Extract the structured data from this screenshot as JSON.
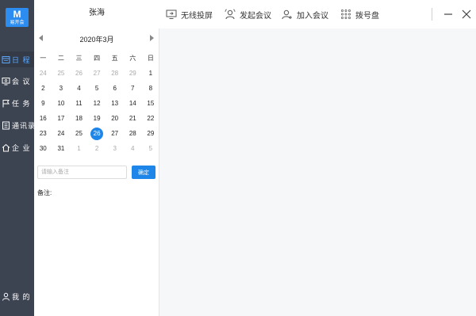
{
  "app": {
    "logo_mark": "M",
    "logo_text": "易开会"
  },
  "sidebar": {
    "items": [
      {
        "label": "日 程",
        "icon": "calendar-icon",
        "active": true
      },
      {
        "label": "会 议",
        "icon": "monitor-icon",
        "active": false
      },
      {
        "label": "任 务",
        "icon": "flag-icon",
        "active": false
      },
      {
        "label": "通讯录",
        "icon": "contacts-icon",
        "active": false
      },
      {
        "label": "企 业",
        "icon": "home-icon",
        "active": false
      }
    ],
    "profile": {
      "label": "我 的",
      "icon": "user-icon"
    }
  },
  "header": {
    "user_name": "张海",
    "buttons": [
      {
        "label": "无线投屏",
        "icon": "cast-screen-icon"
      },
      {
        "label": "发起会议",
        "icon": "start-meeting-icon"
      },
      {
        "label": "加入会议",
        "icon": "join-meeting-icon"
      },
      {
        "label": "拨号盘",
        "icon": "dialpad-icon"
      }
    ]
  },
  "calendar": {
    "month_title": "2020年3月",
    "weekdays": [
      "一",
      "二",
      "三",
      "四",
      "五",
      "六",
      "日"
    ],
    "weeks": [
      [
        {
          "d": "24",
          "other": true
        },
        {
          "d": "25",
          "other": true
        },
        {
          "d": "26",
          "other": true
        },
        {
          "d": "27",
          "other": true
        },
        {
          "d": "28",
          "other": true
        },
        {
          "d": "29",
          "other": true
        },
        {
          "d": "1"
        }
      ],
      [
        {
          "d": "2"
        },
        {
          "d": "3"
        },
        {
          "d": "4"
        },
        {
          "d": "5"
        },
        {
          "d": "6"
        },
        {
          "d": "7"
        },
        {
          "d": "8"
        }
      ],
      [
        {
          "d": "9"
        },
        {
          "d": "10"
        },
        {
          "d": "11"
        },
        {
          "d": "12"
        },
        {
          "d": "13"
        },
        {
          "d": "14"
        },
        {
          "d": "15"
        }
      ],
      [
        {
          "d": "16"
        },
        {
          "d": "17"
        },
        {
          "d": "18"
        },
        {
          "d": "19"
        },
        {
          "d": "20"
        },
        {
          "d": "21"
        },
        {
          "d": "22"
        }
      ],
      [
        {
          "d": "23"
        },
        {
          "d": "24"
        },
        {
          "d": "25"
        },
        {
          "d": "26",
          "today": true
        },
        {
          "d": "27"
        },
        {
          "d": "28"
        },
        {
          "d": "29"
        }
      ],
      [
        {
          "d": "30"
        },
        {
          "d": "31"
        },
        {
          "d": "1",
          "other": true
        },
        {
          "d": "2",
          "other": true
        },
        {
          "d": "3",
          "other": true
        },
        {
          "d": "4",
          "other": true
        },
        {
          "d": "5",
          "other": true
        }
      ]
    ],
    "note": {
      "placeholder": "请输入备注",
      "confirm_label": "确定",
      "label": "备注:"
    }
  },
  "colors": {
    "sidebar_bg": "#3d4451",
    "accent": "#1e86e8",
    "active_nav": "#5aa8ff"
  }
}
